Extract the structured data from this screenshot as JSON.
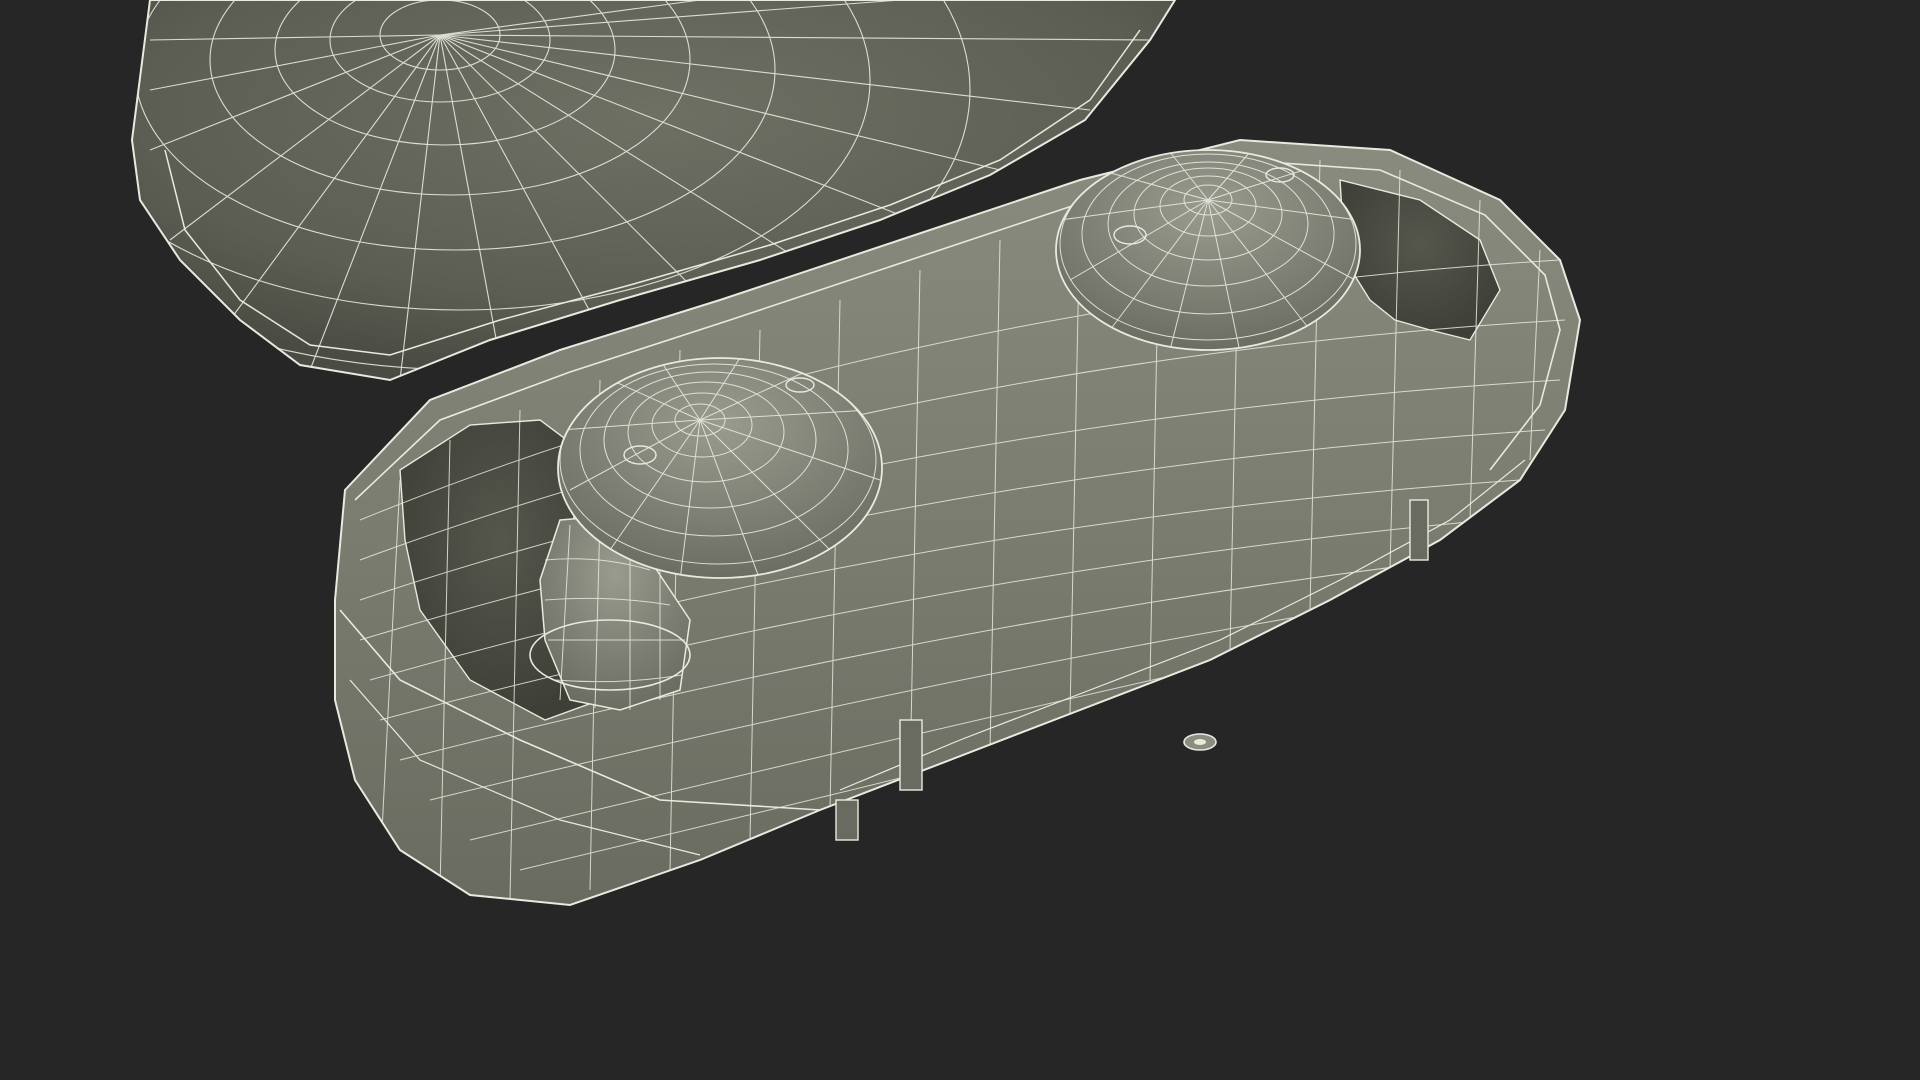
{
  "scene": {
    "background_color": "#262626",
    "surface_color": "#7a7b6f",
    "surface_shadow_color": "#55574d",
    "wire_color": "#e9eadf",
    "objects": [
      "earbud-case-lid",
      "earbud-case-base",
      "left-earbud",
      "right-earbud",
      "case-led-indicator"
    ],
    "render_style": "wireframe-over-shaded"
  }
}
